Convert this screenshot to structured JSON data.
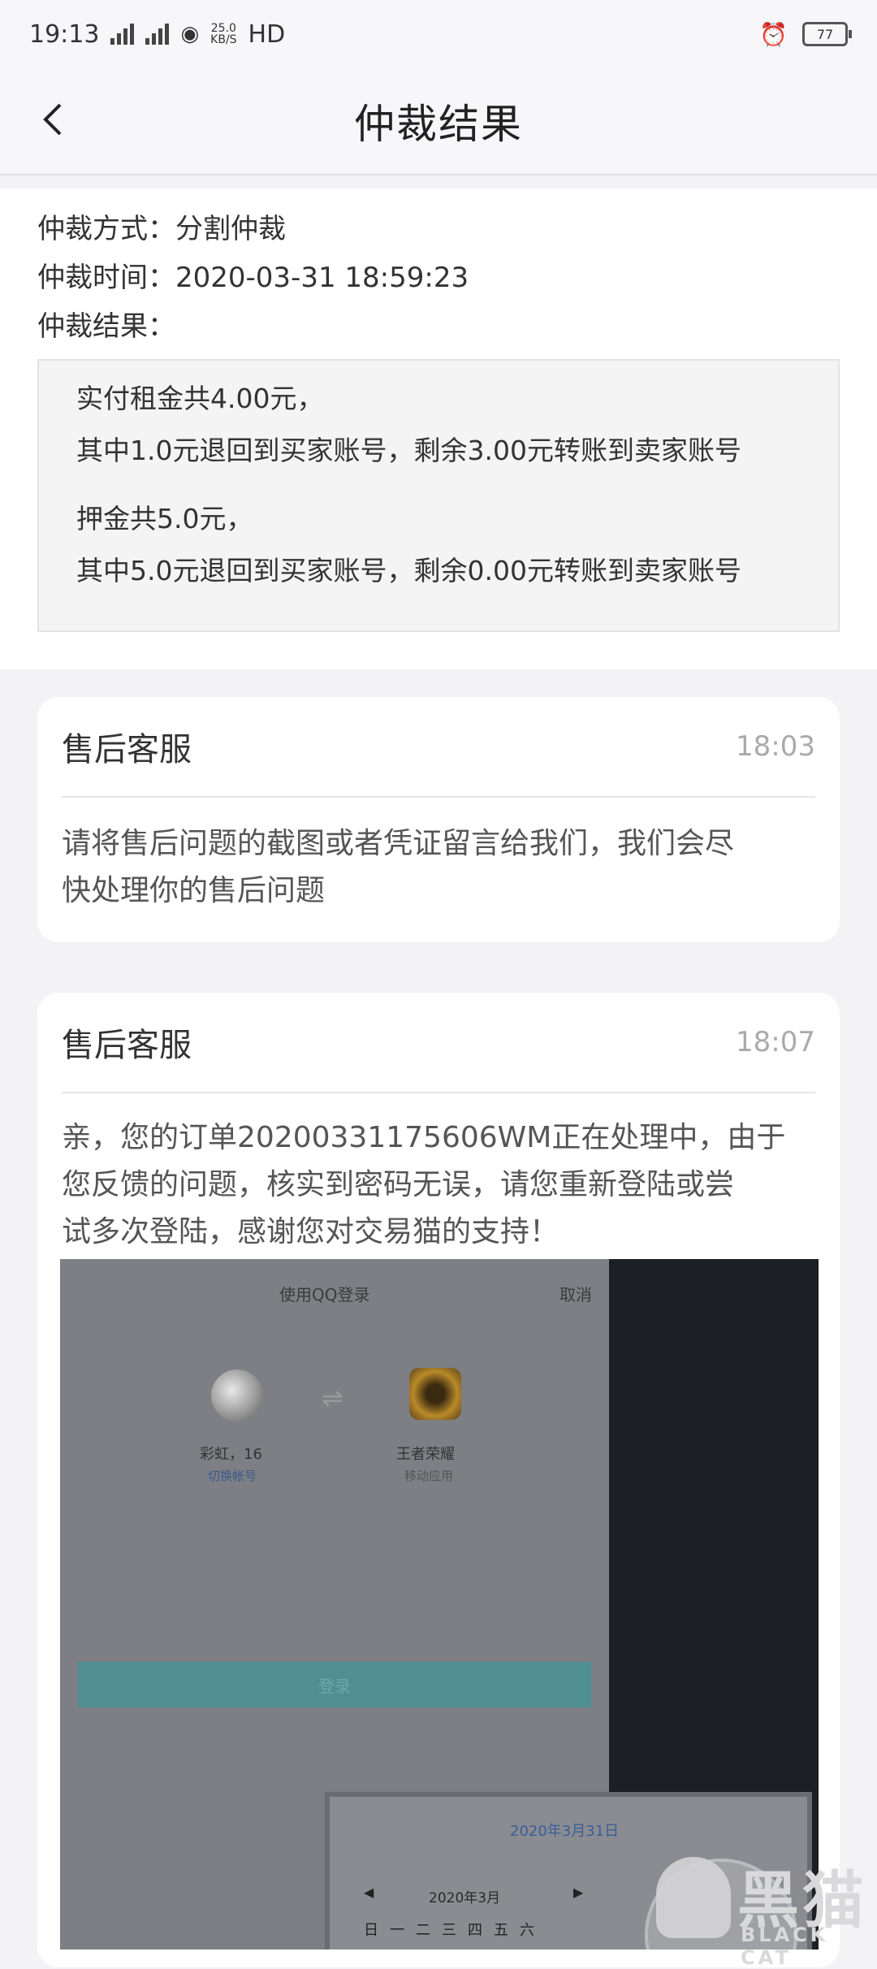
{
  "status_bar": {
    "time": "19:13",
    "network1": "4G",
    "network2": "4G",
    "speed": "25.0",
    "speed_unit": "KB/S",
    "hd": "HD",
    "battery": "77"
  },
  "navbar": {
    "back_icon": "chevron-left-icon",
    "title": "仲裁结果"
  },
  "arbitration": {
    "method": "仲裁方式：分割仲裁",
    "time": "仲裁时间：2020-03-31 18:59:23",
    "result_label": "仲裁结果：",
    "result_lines": [
      "实付租金共4.00元，",
      "其中1.0元退回到买家账号，剩余3.00元转账到卖家账号",
      "押金共5.0元，",
      "其中5.0元退回到买家账号，剩余0.00元转账到卖家账号"
    ]
  },
  "messages": [
    {
      "sender": "售后客服",
      "time": "18:03",
      "text_lines": [
        "请将售后问题的截图或者凭证留言给我们，我们会尽",
        "快处理你的售后问题"
      ]
    },
    {
      "sender": "售后客服",
      "time": "18:07",
      "text_lines": [
        "亲，您的订单20200331175606WM正在处理中，由于",
        "您反馈的问题，核实到密码无误，请您重新登陆或尝",
        "试多次登陆，感谢您对交易猫的支持！"
      ]
    }
  ],
  "screenshot": {
    "title": "使用QQ登录",
    "cancel": "取消",
    "user1_name": "彩虹，16",
    "user1_sub": "切换帐号",
    "user2_name": "王者荣耀",
    "user2_sub": "移动应用",
    "login_button": "登录",
    "calendar_date": "2020年3月31日",
    "calendar_month": "2020年3月",
    "calendar_weekdays": "日一二三四五六"
  },
  "watermark": {
    "text": "黑猫",
    "sub": "BLACK CAT"
  }
}
